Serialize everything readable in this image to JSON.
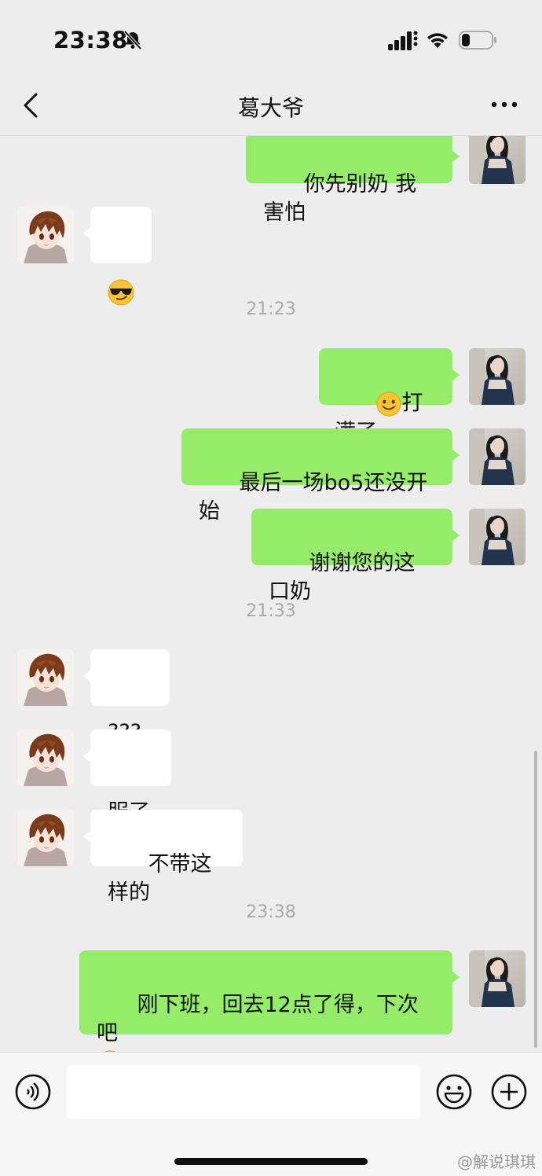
{
  "status": {
    "time": "23:38",
    "icons": [
      "bell-slash-icon",
      "signal-icon",
      "wifi-icon",
      "battery-icon"
    ]
  },
  "nav": {
    "title": "葛大爷",
    "back_icon": "chevron-left-icon",
    "more_icon": "more-dots-icon"
  },
  "colors": {
    "my_bubble": "#95ec69",
    "their_bubble": "#ffffff",
    "background": "#ededed"
  },
  "messages": [
    {
      "from": "me",
      "text": "你先别奶 我害怕"
    },
    {
      "from": "other",
      "emoji": "sunglasses-emoji"
    },
    {
      "type": "time",
      "text": "21:23"
    },
    {
      "from": "me",
      "emoji": "smile-emoji",
      "text": "打满了"
    },
    {
      "from": "me",
      "text": "最后一场bo5还没开始"
    },
    {
      "from": "me",
      "text": "谢谢您的这口奶"
    },
    {
      "type": "time",
      "text": "21:33"
    },
    {
      "from": "other",
      "text": "???"
    },
    {
      "from": "other",
      "text": "服了"
    },
    {
      "from": "other",
      "text": "不带这样的"
    },
    {
      "type": "time",
      "text": "23:38"
    },
    {
      "from": "me",
      "text": "刚下班，回去12点了得，下次吧",
      "emoji": "crying-emoji"
    }
  ],
  "input_bar": {
    "voice_icon": "voice-icon",
    "input_value": "",
    "emoji_icon": "emoji-icon",
    "plus_icon": "plus-icon"
  },
  "watermark": "@解说琪琪"
}
